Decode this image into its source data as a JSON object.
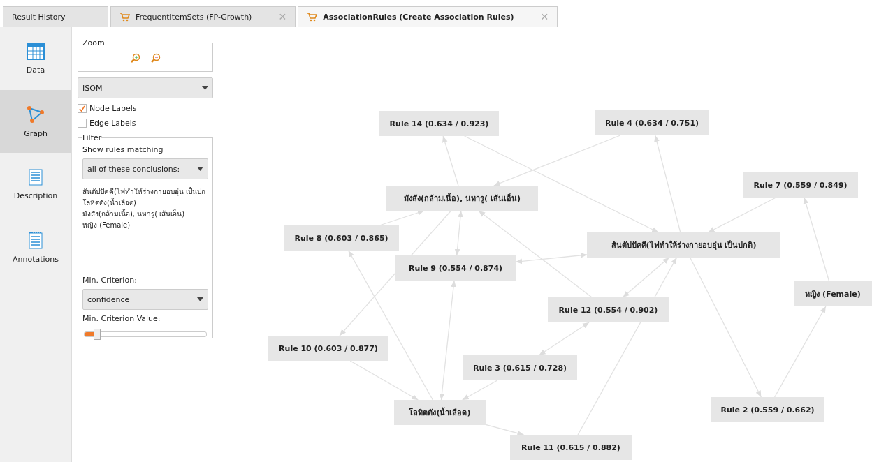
{
  "tabs": [
    {
      "label": "Result History",
      "kind": "plain",
      "selected": false
    },
    {
      "label": "FrequentItemSets (FP-Growth)",
      "kind": "result",
      "close": "✕",
      "selected": false
    },
    {
      "label": "AssociationRules (Create Association Rules)",
      "kind": "result",
      "close": "✕",
      "selected": true
    }
  ],
  "sidebar": {
    "items": [
      {
        "label": "Data",
        "kind": "table",
        "selected": false
      },
      {
        "label": "Graph",
        "kind": "graph",
        "selected": true
      },
      {
        "label": "Description",
        "kind": "text",
        "selected": false
      },
      {
        "label": "Annotations",
        "kind": "notes",
        "selected": false
      }
    ]
  },
  "options": {
    "zoom_title": "Zoom",
    "layout": "ISOM",
    "checkboxes": [
      {
        "label": "Node Labels",
        "checked": true
      },
      {
        "label": "Edge Labels",
        "checked": false
      }
    ],
    "filter_title": "Filter",
    "filter_label": "Show rules matching",
    "filter_mode": "all of these conclusions:",
    "conclusions": [
      "สันตัปปัคคี(ไฟทำให้ร่างกายอบอุ่น เป็นปก",
      "โลหิตตัง(น้ำเลือด)",
      "มังสัง(กล้ามเนื้อ), นหารู( เส้นเอ็น)",
      "หญิง (Female)"
    ],
    "criterion_label": "Min. Criterion:",
    "criterion": "confidence",
    "criterion_value_label": "Min. Criterion Value:",
    "criterion_value": {
      "level": 0.1
    }
  },
  "graph": {
    "nodes": [
      {
        "label": "Rule 14 (0.634 / 0.923)"
      },
      {
        "label": "Rule 4 (0.634 / 0.751)"
      },
      {
        "label": "Rule 7 (0.559 / 0.849)"
      },
      {
        "label": "มังสัง(กล้ามเนื้อ), นหารู( เส้นเอ็น)"
      },
      {
        "label": "สันตัปปัคคี(ไฟทำให้ร่างกายอบอุ่น เป็นปกติ)"
      },
      {
        "label": "Rule 8 (0.603 / 0.865)"
      },
      {
        "label": "Rule 9 (0.554 / 0.874)"
      },
      {
        "label": "หญิง (Female)"
      },
      {
        "label": "Rule 12 (0.554 / 0.902)"
      },
      {
        "label": "Rule 10 (0.603 / 0.877)"
      },
      {
        "label": "Rule 3 (0.615 / 0.728)"
      },
      {
        "label": "โลหิตตัง(น้ำเลือด)"
      },
      {
        "label": "Rule 2 (0.559 / 0.662)"
      },
      {
        "label": "Rule 11 (0.615 / 0.882)"
      }
    ]
  }
}
